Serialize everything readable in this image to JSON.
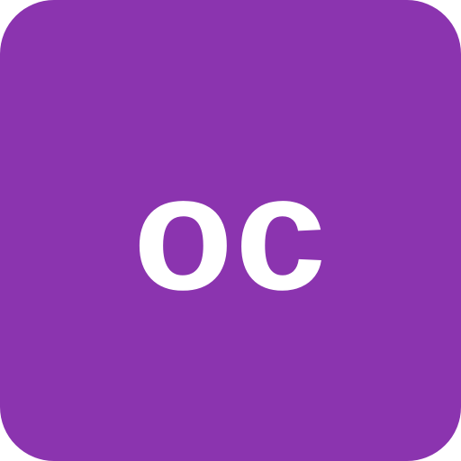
{
  "avatar": {
    "initials": "oc",
    "background_color": "#8b34af",
    "text_color": "#ffffff"
  }
}
